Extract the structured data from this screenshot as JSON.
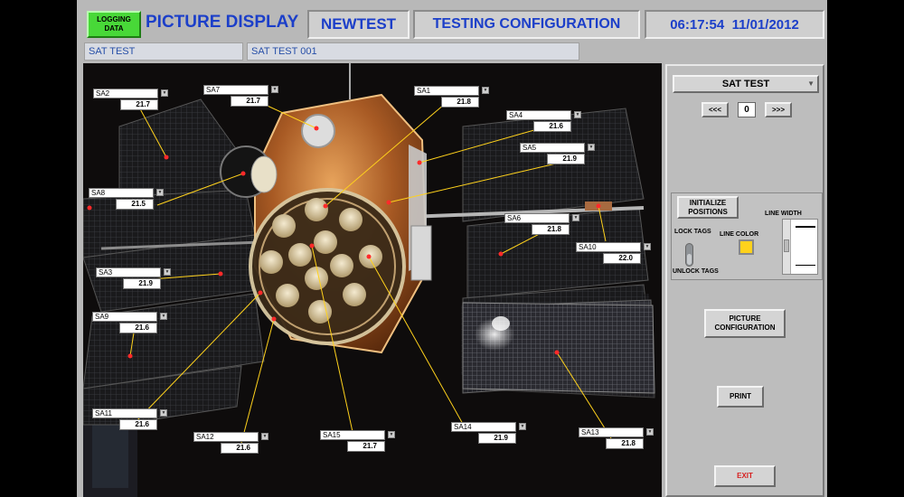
{
  "header": {
    "logging_button": "LOGGING\nDATA",
    "title": "PICTURE DISPLAY",
    "test_name": "NEWTEST",
    "mode": "TESTING CONFIGURATION",
    "datetime": "06:17:54  11/01/2012"
  },
  "subheader": {
    "field1": "SAT TEST",
    "field2": "SAT TEST 001"
  },
  "tags": [
    {
      "name": "SA2",
      "value": "21.7"
    },
    {
      "name": "SA7",
      "value": "21.7"
    },
    {
      "name": "SA1",
      "value": "21.8"
    },
    {
      "name": "SA4",
      "value": "21.6"
    },
    {
      "name": "SA5",
      "value": "21.9"
    },
    {
      "name": "SA8",
      "value": "21.5"
    },
    {
      "name": "SA6",
      "value": "21.8"
    },
    {
      "name": "SA10",
      "value": "22.0"
    },
    {
      "name": "SA3",
      "value": "21.9"
    },
    {
      "name": "SA9",
      "value": "21.6"
    },
    {
      "name": "SA11",
      "value": "21.6"
    },
    {
      "name": "SA12",
      "value": "21.6"
    },
    {
      "name": "SA15",
      "value": "21.7"
    },
    {
      "name": "SA14",
      "value": "21.9"
    },
    {
      "name": "SA13",
      "value": "21.8"
    }
  ],
  "panel": {
    "selected_picture": "SAT TEST",
    "prev_label": "<<<",
    "index": "0",
    "next_label": ">>>",
    "initialize_label": "INITIALIZE\nPOSITIONS",
    "lock_tags": "LOCK TAGS",
    "unlock_tags": "UNLOCK TAGS",
    "line_color_label": "LINE COLOR",
    "line_width_label": "LINE WIDTH",
    "line_color": "#ffd21c",
    "picture_config_label": "PICTURE\nCONFIGURATION",
    "print_label": "PRINT",
    "exit_label": "EXIT"
  },
  "colors": {
    "title_blue": "#1c3fc9",
    "panel_gray": "#b8b8b8",
    "logging_green": "#48d838",
    "exit_red": "#d62020",
    "marker_red": "#ff2a2a"
  }
}
